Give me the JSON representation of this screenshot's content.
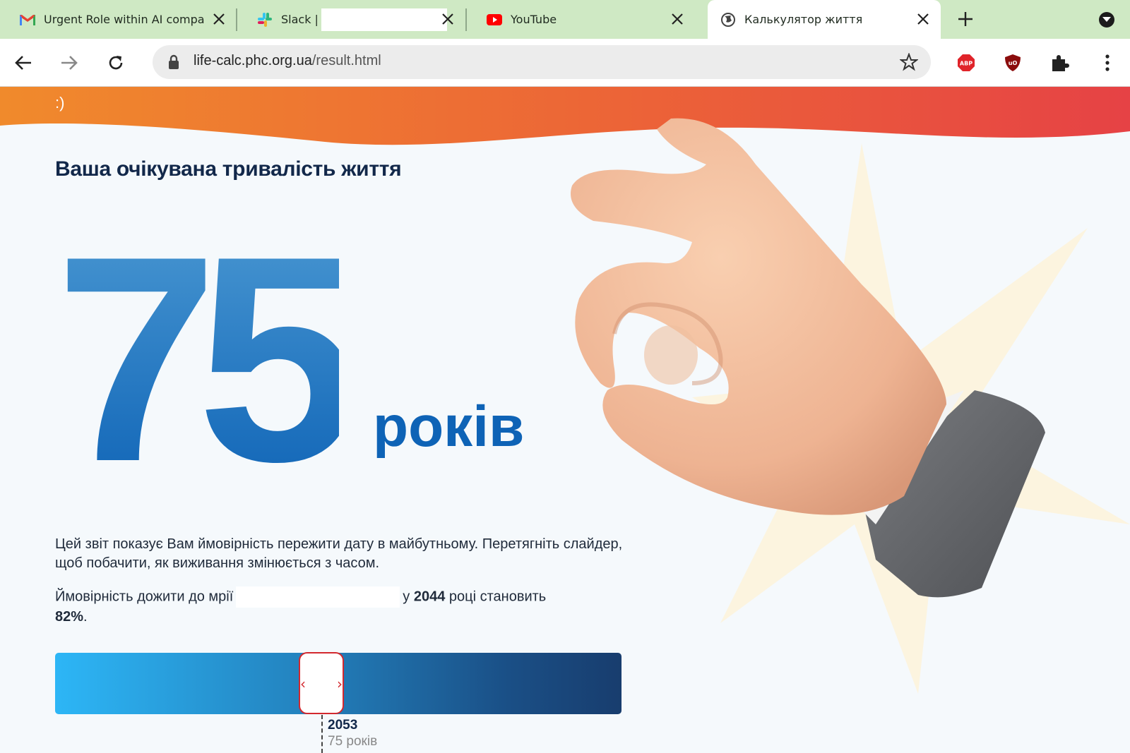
{
  "browser": {
    "tabs": [
      {
        "title": "Urgent Role within AI company",
        "icon": "gmail-icon"
      },
      {
        "title": "Slack |",
        "icon": "slack-icon"
      },
      {
        "title": "YouTube",
        "icon": "youtube-icon"
      },
      {
        "title": "Калькулятор життя",
        "icon": "globe-icon",
        "active": true
      }
    ],
    "address": {
      "domain": "life-calc.phc.org.ua",
      "path": "/result.html"
    },
    "extensions": [
      "adblock-plus-icon",
      "ublock-origin-icon",
      "extensions-icon"
    ]
  },
  "page": {
    "banner_text": ":)",
    "heading": "Ваша очікувана тривалість життя",
    "big_number": "75",
    "years_label": "років",
    "description": "Цей звіт показує Вам ймовірність пережити дату в майбутньому. Перетягніть слайдер, щоб побачити, як виживання змінюється з часом.",
    "probability": {
      "prefix": "Ймовірність дожити до мрії",
      "middle": "у",
      "year": "2044",
      "suffix": "році становить",
      "percent": "82%",
      "end": "."
    },
    "slider": {
      "position": 0.47,
      "marker_year": "2053",
      "marker_age": "75 років"
    }
  },
  "colors": {
    "tab_strip": "#cfe9c4",
    "banner_start": "#f08a2c",
    "banner_end": "#e64245",
    "heading": "#12284a",
    "big_number": "#0e63b6",
    "slider_thumb": "#d3282e"
  }
}
